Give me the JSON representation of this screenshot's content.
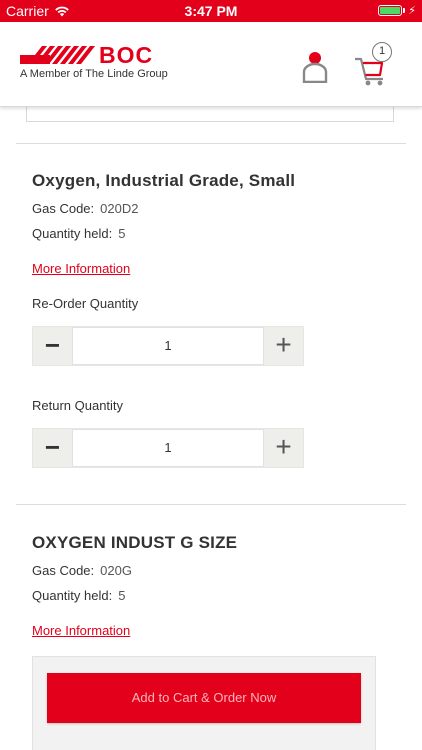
{
  "status_bar": {
    "carrier": "Carrier",
    "time": "3:47 PM",
    "wifi_icon": "wifi-icon",
    "battery_icon": "battery-icon",
    "charging_icon": "lightning-icon",
    "bg_color": "#e2001a"
  },
  "header": {
    "logo_text": "BOC",
    "logo_tagline": "A Member of The Linde Group",
    "user_icon": "user-icon",
    "cart_icon": "cart-icon",
    "cart_count": "1",
    "brand_color": "#e2001a"
  },
  "products": [
    {
      "title": "Oxygen, Industrial Grade, Small",
      "gas_code_label": "Gas Code:",
      "gas_code": "020D2",
      "qty_held_label": "Quantity held:",
      "qty_held": "5",
      "more_info": "More Information",
      "reorder_label": "Re-Order Quantity",
      "reorder_value": "1",
      "return_label": "Return Quantity",
      "return_value": "1"
    },
    {
      "title": "OXYGEN INDUST G SIZE",
      "gas_code_label": "Gas Code:",
      "gas_code": "020G",
      "qty_held_label": "Quantity held:",
      "qty_held": "5",
      "more_info": "More Information"
    }
  ],
  "stepper": {
    "minus": "−",
    "plus": "+"
  },
  "order": {
    "button_label": "Add to Cart & Order Now"
  }
}
